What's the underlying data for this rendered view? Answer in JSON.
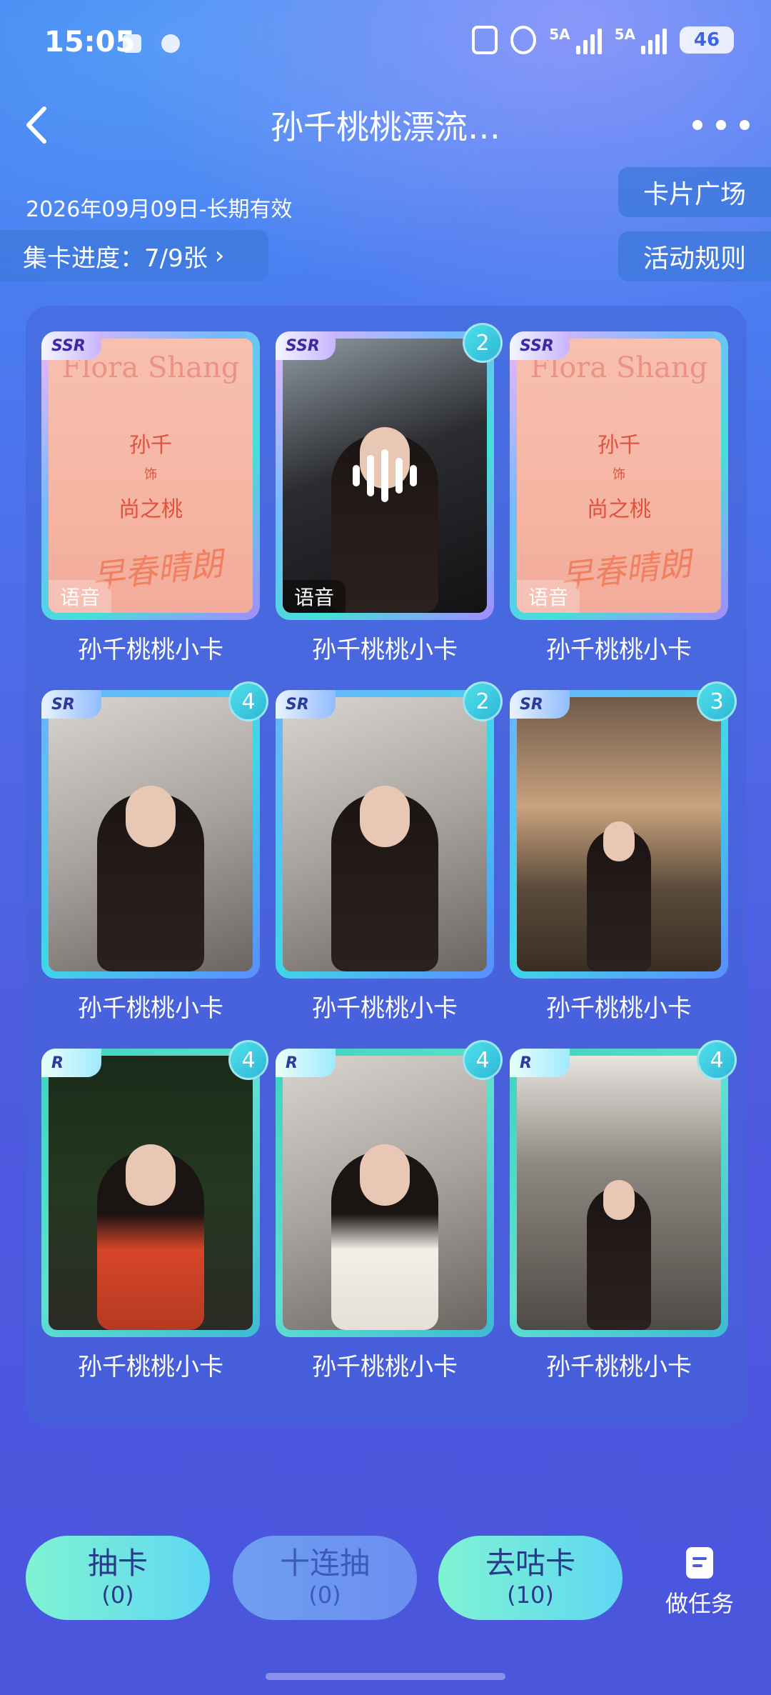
{
  "status_bar": {
    "time": "15:05",
    "signal_1": "5A",
    "signal_2": "5A",
    "battery": "46"
  },
  "header": {
    "title": "孙千桃桃漂流…",
    "back_icon": "chevron-left-icon",
    "more_icon": "more-dots-icon"
  },
  "validity": "2026年09月09日-长期有效",
  "progress": {
    "label": "集卡进度：7/9张",
    "chevron": "›"
  },
  "side_buttons": {
    "square": "卡片广场",
    "rules": "活动规则"
  },
  "cards": [
    {
      "rarity": "SSR",
      "count": "",
      "voice": "语音",
      "name": "孙千桃桃小卡",
      "type": "poster",
      "poster_en": "Flora Shang",
      "poster_l1": "孙千",
      "poster_l2": "饰",
      "poster_l3": "尚之桃",
      "poster_logo": "早春晴朗"
    },
    {
      "rarity": "SSR",
      "count": "2",
      "voice": "语音",
      "name": "孙千桃桃小卡",
      "type": "photo-voice"
    },
    {
      "rarity": "SSR",
      "count": "",
      "voice": "语音",
      "name": "孙千桃桃小卡",
      "type": "poster",
      "poster_en": "Flora Shang",
      "poster_l1": "孙千",
      "poster_l2": "饰",
      "poster_l3": "尚之桃",
      "poster_logo": "早春晴朗"
    },
    {
      "rarity": "SR",
      "count": "4",
      "name": "孙千桃桃小卡"
    },
    {
      "rarity": "SR",
      "count": "2",
      "name": "孙千桃桃小卡"
    },
    {
      "rarity": "SR",
      "count": "3",
      "name": "孙千桃桃小卡"
    },
    {
      "rarity": "R",
      "count": "4",
      "name": "孙千桃桃小卡"
    },
    {
      "rarity": "R",
      "count": "4",
      "name": "孙千桃桃小卡"
    },
    {
      "rarity": "R",
      "count": "4",
      "name": "孙千桃桃小卡"
    }
  ],
  "actions": {
    "draw": {
      "label": "抽卡",
      "count": "(0)"
    },
    "ten": {
      "label": "十连抽",
      "count": "(0)"
    },
    "trade": {
      "label": "去咕卡",
      "count": "(10)"
    },
    "task": {
      "label": "做任务",
      "icon": "task-list-icon"
    }
  },
  "colors": {
    "accent_green": "#7ff3d2",
    "background": "#4a66e4"
  }
}
